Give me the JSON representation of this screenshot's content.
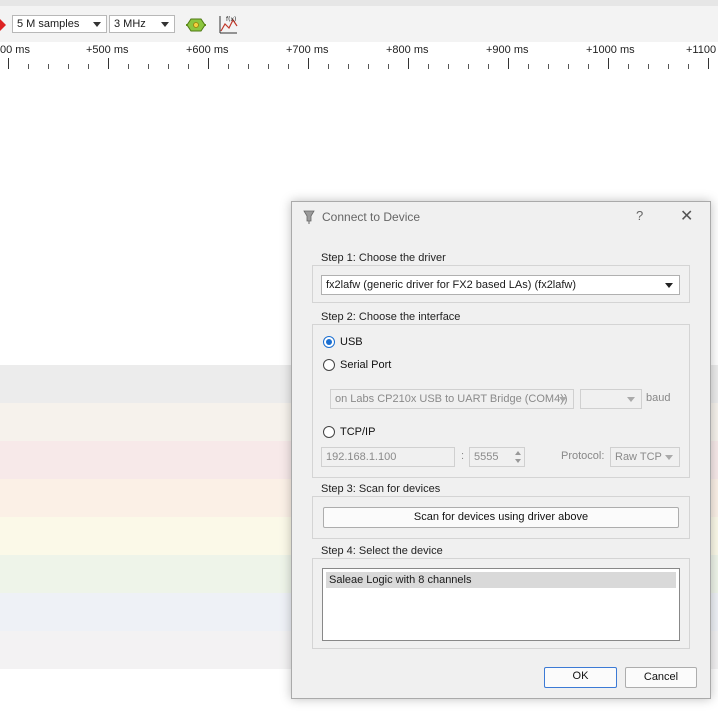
{
  "toolbar": {
    "samples": "5 M samples",
    "rate": "3 MHz",
    "probe_icon": "probe-config-icon",
    "math_icon": "function-plot-icon"
  },
  "ruler": {
    "ticks": [
      "00 ms",
      "+500 ms",
      "+600 ms",
      "+700 ms",
      "+800 ms",
      "+900 ms",
      "+1000 ms",
      "+1100"
    ]
  },
  "channels": {
    "colors": [
      "#ececec",
      "#f6f2ec",
      "#f7e9e9",
      "#fbf0e6",
      "#fbf9e8",
      "#eef4e9",
      "#eef1f6",
      "#f3f2f3"
    ]
  },
  "dialog": {
    "title": "Connect to Device",
    "help": "?",
    "close": "✕",
    "step1": {
      "label": "Step 1: Choose the driver",
      "driver": "fx2lafw (generic driver for FX2 based LAs) (fx2lafw)"
    },
    "step2": {
      "label": "Step 2: Choose the interface",
      "usb": "USB",
      "serial": "Serial Port",
      "serial_port": "on Labs CP210x USB to UART Bridge (COM4))",
      "baud_value": "",
      "baud": "baud",
      "tcpip": "TCP/IP",
      "host": "192.168.1.100",
      "colon": ":",
      "port": "5555",
      "protocol_label": "Protocol:",
      "protocol": "Raw TCP"
    },
    "step3": {
      "label": "Step 3: Scan for devices",
      "scan_button": "Scan for devices using driver above"
    },
    "step4": {
      "label": "Step 4: Select the device",
      "devices": [
        "Saleae Logic with 8 channels"
      ]
    },
    "ok": "OK",
    "cancel": "Cancel"
  }
}
